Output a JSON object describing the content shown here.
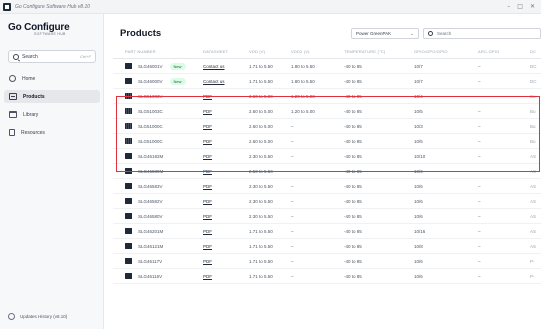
{
  "window": {
    "title": "Go Configure Software Hub v8.10",
    "controls": [
      "–",
      "□",
      "✕"
    ]
  },
  "sidebar": {
    "logo": "Go Configure",
    "logo_sub": "SOFTWARE HUB",
    "search_label": "Search",
    "search_shortcut": "Ctrl+F",
    "items": [
      {
        "label": "Home",
        "icon": "home-icon"
      },
      {
        "label": "Products",
        "icon": "products-icon"
      },
      {
        "label": "Library",
        "icon": "library-icon"
      },
      {
        "label": "Resources",
        "icon": "resources-icon"
      }
    ],
    "updates_label": "Updates History (v8.10)"
  },
  "main": {
    "title": "Products",
    "filter_value": "Power GreenPAK",
    "search_placeholder": "Search",
    "columns": [
      "PART NUMBER",
      "DATASHEET",
      "VDD (V)",
      "VDD2 (V)",
      "TEMPERATURE (°C)",
      "GPIO/GPO/GPIO",
      "ARC-GPIO",
      "DC"
    ],
    "rows": [
      {
        "part": "SLG46001V",
        "badge": "New",
        "datasheet": "Contact us",
        "vdd": "1.71 to 5.50",
        "vdd2": "1.80 to 5.50",
        "temp": "-40 to 85",
        "gpio": "10/7",
        "arc": "–",
        "extra": "DC"
      },
      {
        "part": "SLG46000V",
        "badge": "New",
        "datasheet": "Contact us",
        "vdd": "1.71 to 5.50",
        "vdd2": "1.80 to 5.50",
        "temp": "-40 to 85",
        "gpio": "10/7",
        "arc": "–",
        "extra": "DC"
      },
      {
        "part": "SLG51003V",
        "badge": "",
        "datasheet": "PDF",
        "vdd": "2.60 to 5.00",
        "vdd2": "1.20 to 5.00",
        "temp": "-40 to 85",
        "gpio": "10/4",
        "arc": "–",
        "extra": "Bu"
      },
      {
        "part": "SLG51003C",
        "badge": "",
        "datasheet": "PDF",
        "vdd": "2.60 to 5.00",
        "vdd2": "1.20 to 5.00",
        "temp": "-40 to 85",
        "gpio": "10/5",
        "arc": "–",
        "extra": "Bu"
      },
      {
        "part": "SLG51000C",
        "badge": "",
        "datasheet": "PDF",
        "vdd": "2.60 to 5.00",
        "vdd2": "–",
        "temp": "-40 to 85",
        "gpio": "10/3",
        "arc": "–",
        "extra": "Bu"
      },
      {
        "part": "SLG51000C",
        "badge": "",
        "datasheet": "PDF",
        "vdd": "2.60 to 5.00",
        "vdd2": "–",
        "temp": "-40 to 85",
        "gpio": "10/5",
        "arc": "–",
        "extra": "Bu"
      },
      {
        "part": "SLG46182M",
        "badge": "",
        "datasheet": "PDF",
        "vdd": "2.30 to 5.50",
        "vdd2": "–",
        "temp": "-40 to 85",
        "gpio": "10/10",
        "arc": "–",
        "extra": "AS"
      },
      {
        "part": "SLG46589M",
        "badge": "",
        "datasheet": "PDF",
        "vdd": "2.50 to 5.50",
        "vdd2": "–",
        "temp": "-40 to 85",
        "gpio": "10/6",
        "arc": "–",
        "extra": "AS"
      },
      {
        "part": "SLG46583V",
        "badge": "",
        "datasheet": "PDF",
        "vdd": "2.30 to 5.50",
        "vdd2": "–",
        "temp": "-40 to 85",
        "gpio": "10/6",
        "arc": "–",
        "extra": "AS"
      },
      {
        "part": "SLG46582V",
        "badge": "",
        "datasheet": "PDF",
        "vdd": "2.30 to 5.50",
        "vdd2": "–",
        "temp": "-40 to 85",
        "gpio": "10/6",
        "arc": "–",
        "extra": "AS"
      },
      {
        "part": "SLG46580V",
        "badge": "",
        "datasheet": "PDF",
        "vdd": "2.30 to 5.50",
        "vdd2": "–",
        "temp": "-40 to 85",
        "gpio": "10/6",
        "arc": "–",
        "extra": "AS"
      },
      {
        "part": "SLG46201M",
        "badge": "",
        "datasheet": "PDF",
        "vdd": "1.71 to 5.50",
        "vdd2": "–",
        "temp": "-40 to 85",
        "gpio": "10/16",
        "arc": "–",
        "extra": "AS"
      },
      {
        "part": "SLG46121M",
        "badge": "",
        "datasheet": "PDF",
        "vdd": "1.71 to 5.50",
        "vdd2": "–",
        "temp": "-40 to 85",
        "gpio": "10/8",
        "arc": "–",
        "extra": "AS"
      },
      {
        "part": "SLG46117V",
        "badge": "",
        "datasheet": "PDF",
        "vdd": "1.71 to 5.50",
        "vdd2": "–",
        "temp": "-40 to 85",
        "gpio": "10/6",
        "arc": "–",
        "extra": "P-"
      },
      {
        "part": "SLG46116V",
        "badge": "",
        "datasheet": "PDF",
        "vdd": "1.71 to 5.50",
        "vdd2": "–",
        "temp": "-40 to 85",
        "gpio": "10/6",
        "arc": "–",
        "extra": "P-"
      }
    ]
  },
  "colors": {
    "highlight": "#e0313f",
    "badge_bg": "#dcfce7",
    "badge_text": "#166534",
    "sidebar_bg": "#f7f8fa"
  }
}
